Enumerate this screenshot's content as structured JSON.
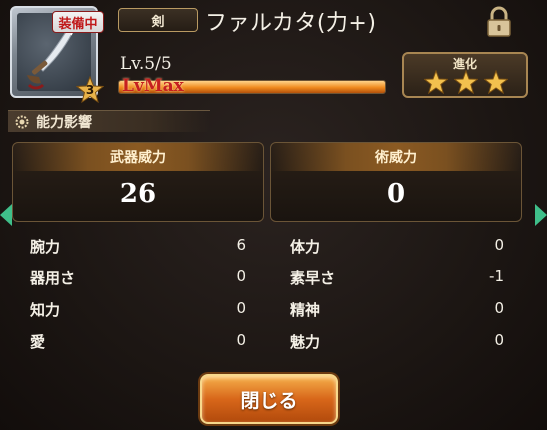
{
  "item": {
    "equip_badge": "装備中",
    "type_label": "剣",
    "name": "ファルカタ(力+)",
    "level_text": "Lv.5/5",
    "level_max_label": "LvMax",
    "rarity": "3",
    "xp_fraction": 1.0
  },
  "evolution": {
    "label": "進化",
    "stars_filled": 3,
    "stars_total": 3
  },
  "section": {
    "title": "能力影響"
  },
  "power": {
    "weapon_label": "武器威力",
    "weapon_value": "26",
    "magic_label": "術威力",
    "magic_value": "0"
  },
  "stats": [
    {
      "label": "腕力",
      "value": "6"
    },
    {
      "label": "体力",
      "value": "0"
    },
    {
      "label": "器用さ",
      "value": "0"
    },
    {
      "label": "素早さ",
      "value": "-1"
    },
    {
      "label": "知力",
      "value": "0"
    },
    {
      "label": "精神",
      "value": "0"
    },
    {
      "label": "愛",
      "value": "0"
    },
    {
      "label": "魅力",
      "value": "0"
    }
  ],
  "buttons": {
    "close_label": "閉じる"
  },
  "colors": {
    "accent_orange": "#e07a1f",
    "equip_red": "#c0191a",
    "gold_border": "#a88652"
  }
}
